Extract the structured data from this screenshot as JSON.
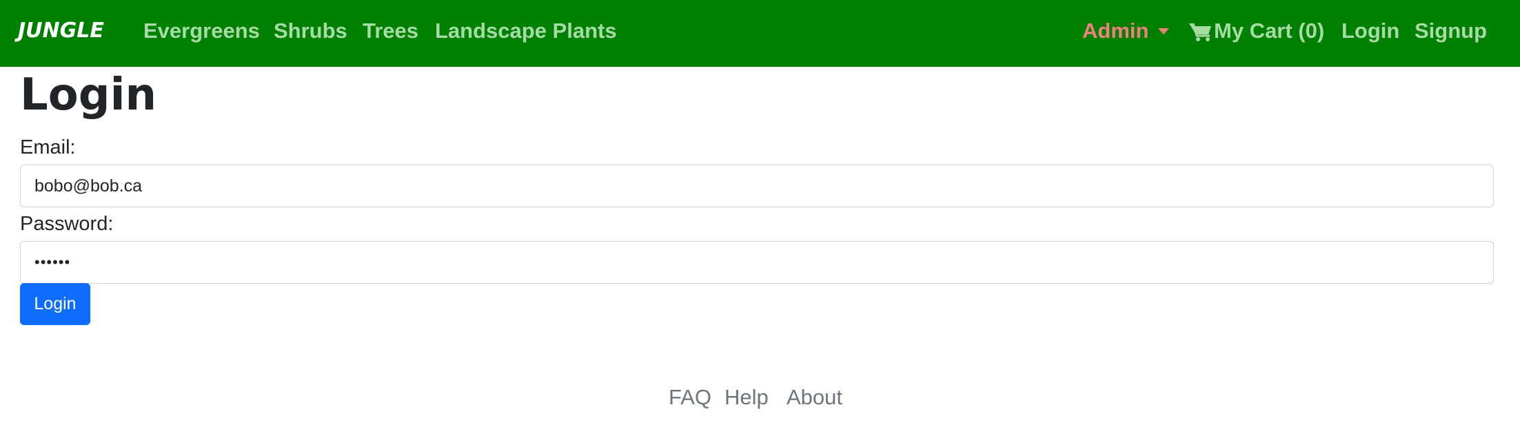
{
  "navbar": {
    "brand": "JUNGLE",
    "links": [
      {
        "label": "Evergreens"
      },
      {
        "label": "Shrubs"
      },
      {
        "label": "Trees"
      },
      {
        "label": "Landscape Plants"
      }
    ],
    "admin_label": "Admin",
    "cart_label": "My Cart (0)",
    "login_label": "Login",
    "signup_label": "Signup",
    "colors": {
      "background": "#008000",
      "link": "#a6dba6",
      "admin": "#f08080",
      "brand": "#ffffff"
    },
    "icons": {
      "cart": "shopping-cart-icon",
      "admin_caret": "caret-down-icon"
    }
  },
  "page": {
    "title": "Login"
  },
  "form": {
    "email_label": "Email:",
    "email_value": "bobo@bob.ca",
    "password_label": "Password:",
    "password_value": "••••••",
    "submit_label": "Login",
    "colors": {
      "button": "#0d6efd",
      "input_border": "#ced4da"
    }
  },
  "footer": {
    "links": [
      {
        "label": "FAQ"
      },
      {
        "label": "Help"
      },
      {
        "label": "About"
      }
    ],
    "color": "#6c757d"
  }
}
